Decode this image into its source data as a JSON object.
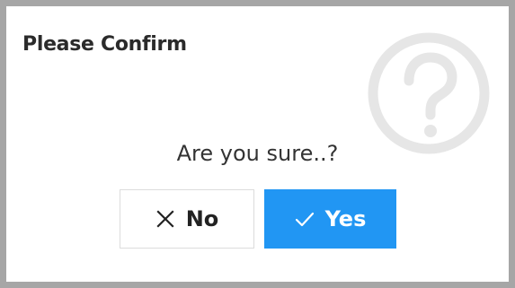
{
  "dialog": {
    "title": "Please Confirm",
    "message": "Are you sure..?",
    "watermark_icon": "question-circle-icon",
    "buttons": {
      "no": {
        "label": "No",
        "icon": "close-icon"
      },
      "yes": {
        "label": "Yes",
        "icon": "check-icon",
        "color": "#2196f3"
      }
    }
  }
}
